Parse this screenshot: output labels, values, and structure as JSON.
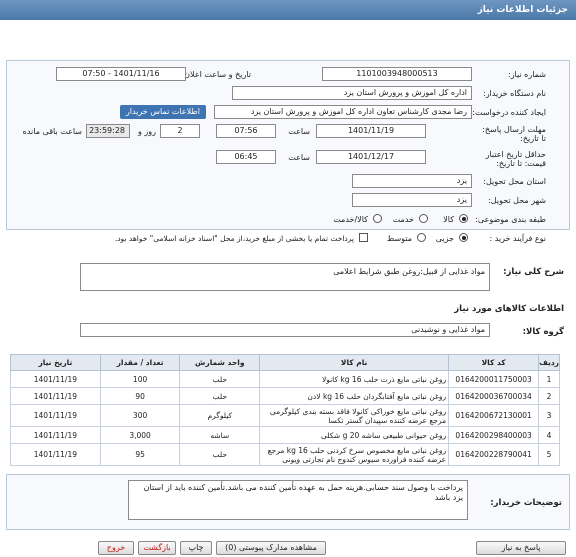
{
  "header": {
    "title": "جزئیات اطلاعات نیاز"
  },
  "form": {
    "need_number_label": "شماره نیاز:",
    "need_number": "1101003948000513",
    "announce_datetime_label": "تاریخ و ساعت اعلان عمومی:",
    "announce_datetime": "1401/11/16 - 07:50",
    "buyer_org_label": "نام دستگاه خریدار:",
    "buyer_org": "اداره کل اموزش و پرورش استان یزد",
    "requester_label": "ایجاد کننده درخواست:",
    "requester": "رضا مجدی کارشناس تعاون اداره کل اموزش و پرورش استان یزد",
    "buyer_contact_link": "اطلاعات تماس خریدار",
    "reply_deadline_label": "مهلت ارسال پاسخ: تا تاریخ:",
    "reply_date": "1401/11/19",
    "time_label": "ساعت",
    "reply_time": "07:56",
    "days_value": "2",
    "days_label": "روز و",
    "remaining_time": "23:59:28",
    "remaining_label": "ساعت باقی مانده",
    "min_price_validity_label": "حداقل تاریخ اعتبار قیمت: تا تاریخ:",
    "validity_date": "1401/12/17",
    "validity_time_label": "ساعت",
    "validity_time": "06:45",
    "delivery_province_label": "استان محل تحویل:",
    "delivery_province": "یزد",
    "delivery_city_label": "شهر محل تحویل:",
    "delivery_city": "یزد",
    "category_label": "طبقه بندی موضوعی:",
    "category_options": [
      "کالا",
      "خدمت",
      "کالا/خدمت"
    ],
    "process_label": "نوع فرآیند خرید :",
    "process_options": [
      "جزیی",
      "متوسط"
    ],
    "payment_note": "پرداخت تمام یا بخشی از مبلغ خرید،از محل \"اسناد خزانه اسلامی\" خواهد بود."
  },
  "summary": {
    "label": "شرح کلی نیاز:",
    "value": "مواد غذایی از قبیل:روغن طبق شرایط اعلامی"
  },
  "goods": {
    "title": "اطلاعات کالاهای مورد نیاز",
    "group_label": "گروه کالا:",
    "group_value": "مواد غذایی و نوشیدنی",
    "columns": [
      "ردیف",
      "کد کالا",
      "نام کالا",
      "واحد شمارش",
      "تعداد / مقدار",
      "تاریخ نیاز"
    ],
    "rows": [
      [
        "1",
        "0164200011750003",
        "روغن نباتی مایع ذرت حلب 16 kg کانولا",
        "حلب",
        "100",
        "1401/11/19"
      ],
      [
        "2",
        "0164200036700034",
        "روغن نباتی مایع آفتابگردان حلب 16 kg لادن",
        "حلب",
        "90",
        "1401/11/19"
      ],
      [
        "3",
        "0164200672130001",
        "روغن نباتی مایع خوراکی کانولا فاقد بسته بندی کیلوگرمی مرجع عرضه کننده سپیدان گستر تکسا",
        "کیلوگرم",
        "300",
        "1401/11/19"
      ],
      [
        "4",
        "0164200298400003",
        "روغن حیوانی طبیعی ساشه 20 g شکلی",
        "ساشه",
        "3,000",
        "1401/11/19"
      ],
      [
        "5",
        "0164200228790041",
        "روغن نباتی مایع مخصوص سرخ کردنی حلب 16 kg مرجع عرضه کننده فراورده سبوس کندوج نام تجارتی ویونی",
        "حلب",
        "95",
        "1401/11/19"
      ]
    ]
  },
  "notes": {
    "label": "توضیحات خریدار:",
    "text": "پرداخت با وصول سند حسابی.هزینه حمل به عهده تأمین کننده می باشد.تأمین کننده باید از استان یزد باشد"
  },
  "buttons": {
    "reply": "پاسخ به نیاز",
    "attachments": "مشاهده مدارک پیوستی (0)",
    "print": "چاپ",
    "back": "بازگشت",
    "exit": "خروج"
  }
}
